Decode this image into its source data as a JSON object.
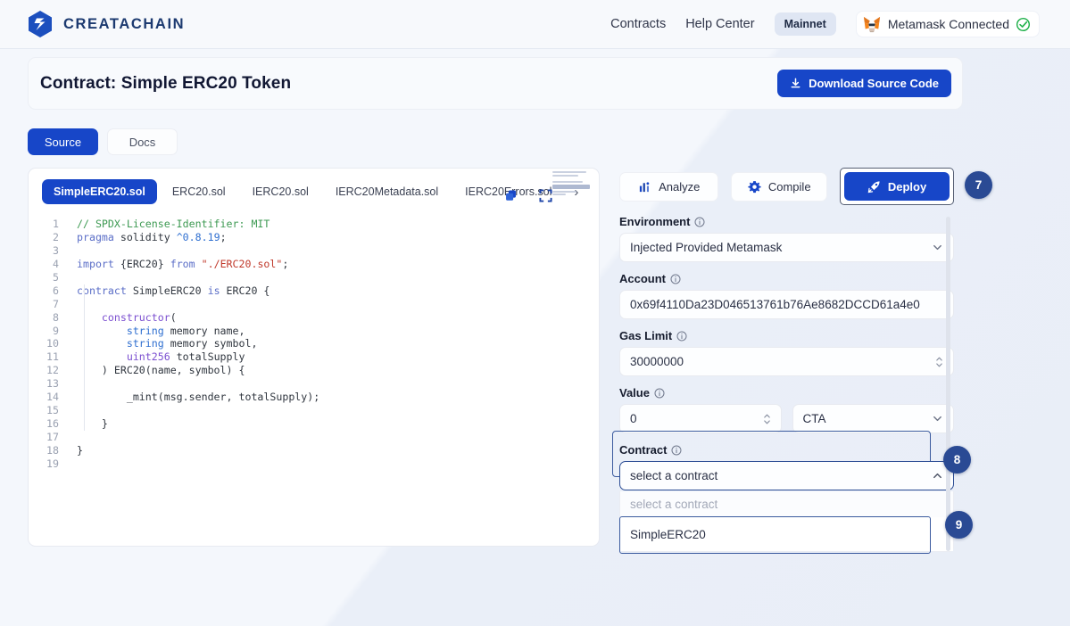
{
  "brand": {
    "name": "CREATACHAIN",
    "logo_icon": "creatachain-hex-logo"
  },
  "nav": {
    "links": [
      {
        "label": "Contracts",
        "name": "nav-link-contracts"
      },
      {
        "label": "Help Center",
        "name": "nav-link-help-center"
      }
    ],
    "network_pill": "Mainnet",
    "wallet": {
      "label": "Metamask Connected",
      "fox_icon": "metamask-fox-icon",
      "status_icon": "check-circle-icon",
      "status_color": "#22b14c"
    }
  },
  "header": {
    "title": "Contract: Simple ERC20 Token",
    "download_button": {
      "label": "Download Source Code",
      "icon": "download-icon"
    }
  },
  "view_tabs": [
    {
      "label": "Source",
      "active": true
    },
    {
      "label": "Docs",
      "active": false
    }
  ],
  "editor": {
    "file_tabs": [
      {
        "label": "SimpleERC20.sol",
        "active": true
      },
      {
        "label": "ERC20.sol",
        "active": false
      },
      {
        "label": "IERC20.sol",
        "active": false
      },
      {
        "label": "IERC20Metadata.sol",
        "active": false
      },
      {
        "label": "IERC20Errors.sol",
        "active": false
      }
    ],
    "more_tabs_icon": "chevron-right-icon",
    "copy_icon": "copy-icon",
    "expand_icon": "fullscreen-icon",
    "minimap_icon": "minimap",
    "line_numbers": [
      "1",
      "2",
      "3",
      "4",
      "5",
      "6",
      "7",
      "8",
      "9",
      "10",
      "11",
      "12",
      "13",
      "14",
      "15",
      "16",
      "17",
      "18",
      "19"
    ],
    "code_lines": [
      "// SPDX-License-Identifier: MIT",
      "pragma solidity ^0.8.19;",
      "",
      "import {ERC20} from \"./ERC20.sol\";",
      "",
      "contract SimpleERC20 is ERC20 {",
      "",
      "    constructor(",
      "        string memory name,",
      "        string memory symbol,",
      "        uint256 totalSupply",
      "    ) ERC20(name, symbol) {",
      "",
      "        _mint(msg.sender, totalSupply);",
      "",
      "    }",
      "",
      "}",
      ""
    ]
  },
  "panel": {
    "actions": [
      {
        "label": "Analyze",
        "icon": "analyze-chart-icon",
        "style": "secondary"
      },
      {
        "label": "Compile",
        "icon": "gear-icon",
        "style": "secondary"
      },
      {
        "label": "Deploy",
        "icon": "rocket-icon",
        "style": "primary"
      }
    ],
    "environment": {
      "label": "Environment",
      "value": "Injected Provided Metamask",
      "info_icon": "info-icon",
      "chevron": "chevron-down-icon"
    },
    "account": {
      "label": "Account",
      "value": "0x69f4110Da23D046513761b76Ae8682DCCD61a4e0",
      "info_icon": "info-icon"
    },
    "gas_limit": {
      "label": "Gas Limit",
      "value": "30000000",
      "info_icon": "info-icon",
      "stepper_icon": "stepper-updown-icon"
    },
    "value": {
      "label": "Value",
      "amount": "0",
      "unit": "CTA",
      "info_icon": "info-icon",
      "stepper_icon": "stepper-updown-icon",
      "chevron": "chevron-down-icon"
    },
    "contract": {
      "label": "Contract",
      "selected": "select a contract",
      "info_icon": "info-icon",
      "chevron": "chevron-up-icon",
      "options": [
        {
          "label": "select a contract",
          "placeholder": true
        },
        {
          "label": "SimpleERC20",
          "placeholder": false
        }
      ]
    }
  },
  "step_badges": [
    {
      "number": "7"
    },
    {
      "number": "8"
    },
    {
      "number": "9"
    }
  ],
  "colors": {
    "primary": "#1746c8",
    "badge": "#2a4a94",
    "page_bg": "#eaeff8"
  }
}
